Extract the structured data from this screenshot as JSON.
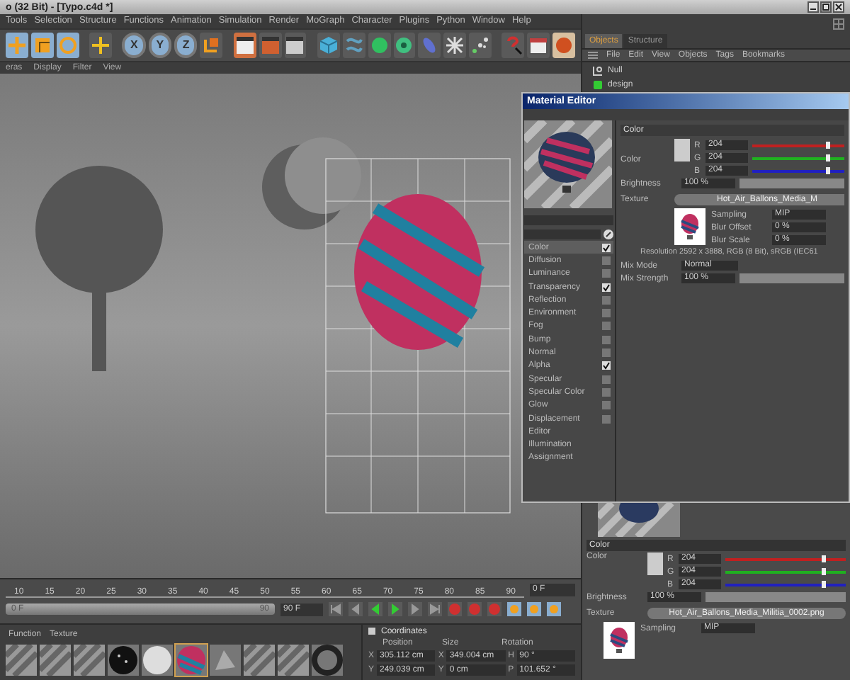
{
  "window": {
    "title": "o (32 Bit) - [Typo.c4d *]"
  },
  "menu": [
    "Tools",
    "Selection",
    "Structure",
    "Functions",
    "Animation",
    "Simulation",
    "Render",
    "MoGraph",
    "Character",
    "Plugins",
    "Python",
    "Window",
    "Help"
  ],
  "axis_buttons": [
    "X",
    "Y",
    "Z"
  ],
  "viewport": {
    "menu": [
      "eras",
      "Display",
      "Filter",
      "View"
    ]
  },
  "object_manager": {
    "tabs": [
      {
        "label": "Objects",
        "selected": true
      },
      {
        "label": "Structure",
        "selected": false
      }
    ],
    "menu": [
      "File",
      "Edit",
      "View",
      "Objects",
      "Tags",
      "Bookmarks"
    ],
    "objects": [
      {
        "name": "Null",
        "kind": "null"
      },
      {
        "name": "design",
        "kind": "object"
      }
    ]
  },
  "material_editor": {
    "title": "Material Editor",
    "channels": [
      {
        "name": "Color",
        "kind": "toggle",
        "checked": true,
        "selected": true
      },
      {
        "name": "Diffusion",
        "kind": "toggle",
        "checked": false,
        "selected": false
      },
      {
        "name": "Luminance",
        "kind": "toggle",
        "checked": false,
        "selected": false
      },
      {
        "name": "Transparency",
        "kind": "toggle",
        "checked": true,
        "selected": false
      },
      {
        "name": "Reflection",
        "kind": "toggle",
        "checked": false,
        "selected": false
      },
      {
        "name": "Environment",
        "kind": "toggle",
        "checked": false,
        "selected": false
      },
      {
        "name": "Fog",
        "kind": "toggle",
        "checked": false,
        "selected": false
      },
      {
        "name": "Bump",
        "kind": "toggle",
        "checked": false,
        "selected": false
      },
      {
        "name": "Normal",
        "kind": "toggle",
        "checked": false,
        "selected": false
      },
      {
        "name": "Alpha",
        "kind": "toggle",
        "checked": true,
        "selected": false
      },
      {
        "name": "Specular",
        "kind": "toggle",
        "checked": false,
        "selected": false
      },
      {
        "name": "Specular Color",
        "kind": "toggle",
        "checked": false,
        "selected": false
      },
      {
        "name": "Glow",
        "kind": "toggle",
        "checked": false,
        "selected": false
      },
      {
        "name": "Displacement",
        "kind": "toggle",
        "checked": false,
        "selected": false
      },
      {
        "name": "Editor",
        "kind": "plain",
        "selected": false
      },
      {
        "name": "Illumination",
        "kind": "plain",
        "selected": false
      },
      {
        "name": "Assignment",
        "kind": "plain",
        "selected": false
      }
    ],
    "section": "Color",
    "color_label": "Color",
    "rgb": [
      {
        "label": "R",
        "value": "204",
        "level": 0.8,
        "color": "#c02020"
      },
      {
        "label": "G",
        "value": "204",
        "level": 0.8,
        "color": "#20b020"
      },
      {
        "label": "B",
        "value": "204",
        "level": 0.8,
        "color": "#2020c0"
      }
    ],
    "brightness": {
      "label": "Brightness",
      "value": "100 %",
      "level": 1
    },
    "texture": {
      "label": "Texture",
      "file": "Hot_Air_Ballons_Media_M"
    },
    "sampling": {
      "label": "Sampling",
      "value": "MIP"
    },
    "blur_offset": {
      "label": "Blur Offset",
      "value": "0 %"
    },
    "blur_scale": {
      "label": "Blur Scale",
      "value": "0 %"
    },
    "resolution": "Resolution 2592 x 3888, RGB (8 Bit), sRGB (IEC61",
    "mix_mode": {
      "label": "Mix Mode",
      "value": "Normal"
    },
    "mix_strength": {
      "label": "Mix Strength",
      "value": "100 %",
      "level": 1
    }
  },
  "attributes": {
    "section": "Color",
    "color_label": "Color",
    "rgb": [
      {
        "label": "R",
        "value": "204",
        "level": 0.8,
        "color": "#c02020"
      },
      {
        "label": "G",
        "value": "204",
        "level": 0.8,
        "color": "#20b020"
      },
      {
        "label": "B",
        "value": "204",
        "level": 0.8,
        "color": "#2020c0"
      }
    ],
    "brightness": {
      "label": "Brightness",
      "value": "100 %",
      "level": 1
    },
    "texture": {
      "label": "Texture",
      "file": "Hot_Air_Ballons_Media_Militia_0002.png"
    },
    "sampling": {
      "label": "Sampling",
      "value": "MIP"
    }
  },
  "timeline": {
    "ticks": [
      "10",
      "15",
      "20",
      "25",
      "30",
      "35",
      "40",
      "45",
      "50",
      "55",
      "60",
      "65",
      "70",
      "75",
      "80",
      "85",
      "90"
    ],
    "current_frame": "0 F",
    "range_start": "0 F",
    "range_end": "90",
    "level": 1,
    "end_frame": "90 F"
  },
  "material_manager": {
    "menu": [
      "Function",
      "Texture"
    ]
  },
  "coordinates": {
    "title": "Coordinates",
    "headers": [
      "Position",
      "Size",
      "Rotation"
    ],
    "rows": [
      [
        {
          "axis": "X",
          "value": "305.112 cm"
        },
        {
          "axis": "X",
          "value": "349.004 cm"
        },
        {
          "axis": "H",
          "value": "90 °"
        }
      ],
      [
        {
          "axis": "Y",
          "value": "249.039 cm"
        },
        {
          "axis": "Y",
          "value": "0 cm"
        },
        {
          "axis": "P",
          "value": "101.652 °"
        }
      ]
    ]
  }
}
